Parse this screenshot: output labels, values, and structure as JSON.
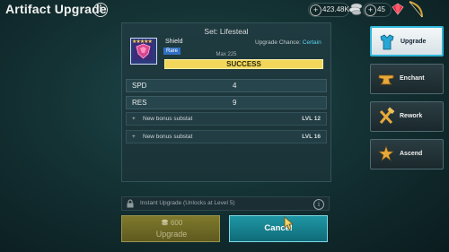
{
  "header": {
    "title": "Artifact Upgrade",
    "info_glyph": "i"
  },
  "resources": {
    "silver": "423.48K",
    "gems": "45",
    "plus_glyph": "+",
    "silver_icon": "silver-coins-icon",
    "gem_icon": "gem-icon",
    "bow_icon": "bow-icon"
  },
  "artifact": {
    "set_title": "Set: Lifesteal",
    "name": "Shield",
    "rarity": "Rare",
    "stars": "★★★★★",
    "chance_label": "Upgrade Chance:",
    "chance_value": "Certain",
    "max": "Max 225",
    "result": "SUCCESS",
    "thumb_icon": "shield-artifact-icon"
  },
  "stats": [
    {
      "name": "SPD",
      "value": "4"
    },
    {
      "name": "RES",
      "value": "9"
    }
  ],
  "substats": [
    {
      "plus": "+",
      "label": "New bonus substat",
      "level": "LVL 12"
    },
    {
      "plus": "+",
      "label": "New bonus substat",
      "level": "LVL 16"
    }
  ],
  "side_menu": [
    {
      "label": "Upgrade",
      "icon": "armor-icon",
      "active": true
    },
    {
      "label": "Enchant",
      "icon": "anvil-icon",
      "active": false
    },
    {
      "label": "Rework",
      "icon": "hammer-wrench-icon",
      "active": false
    },
    {
      "label": "Ascend",
      "icon": "ascend-icon",
      "active": false
    }
  ],
  "instant_upgrade": {
    "label": "Instant Upgrade (Unlocks at Level 5)",
    "info_glyph": "i"
  },
  "buttons": {
    "upgrade_cost": "600",
    "upgrade_label": "Upgrade",
    "cancel_label": "Cancel"
  },
  "colors": {
    "accent": "#2fb6d8",
    "success": "#f2d75a",
    "rare": "#2f6fc4"
  }
}
